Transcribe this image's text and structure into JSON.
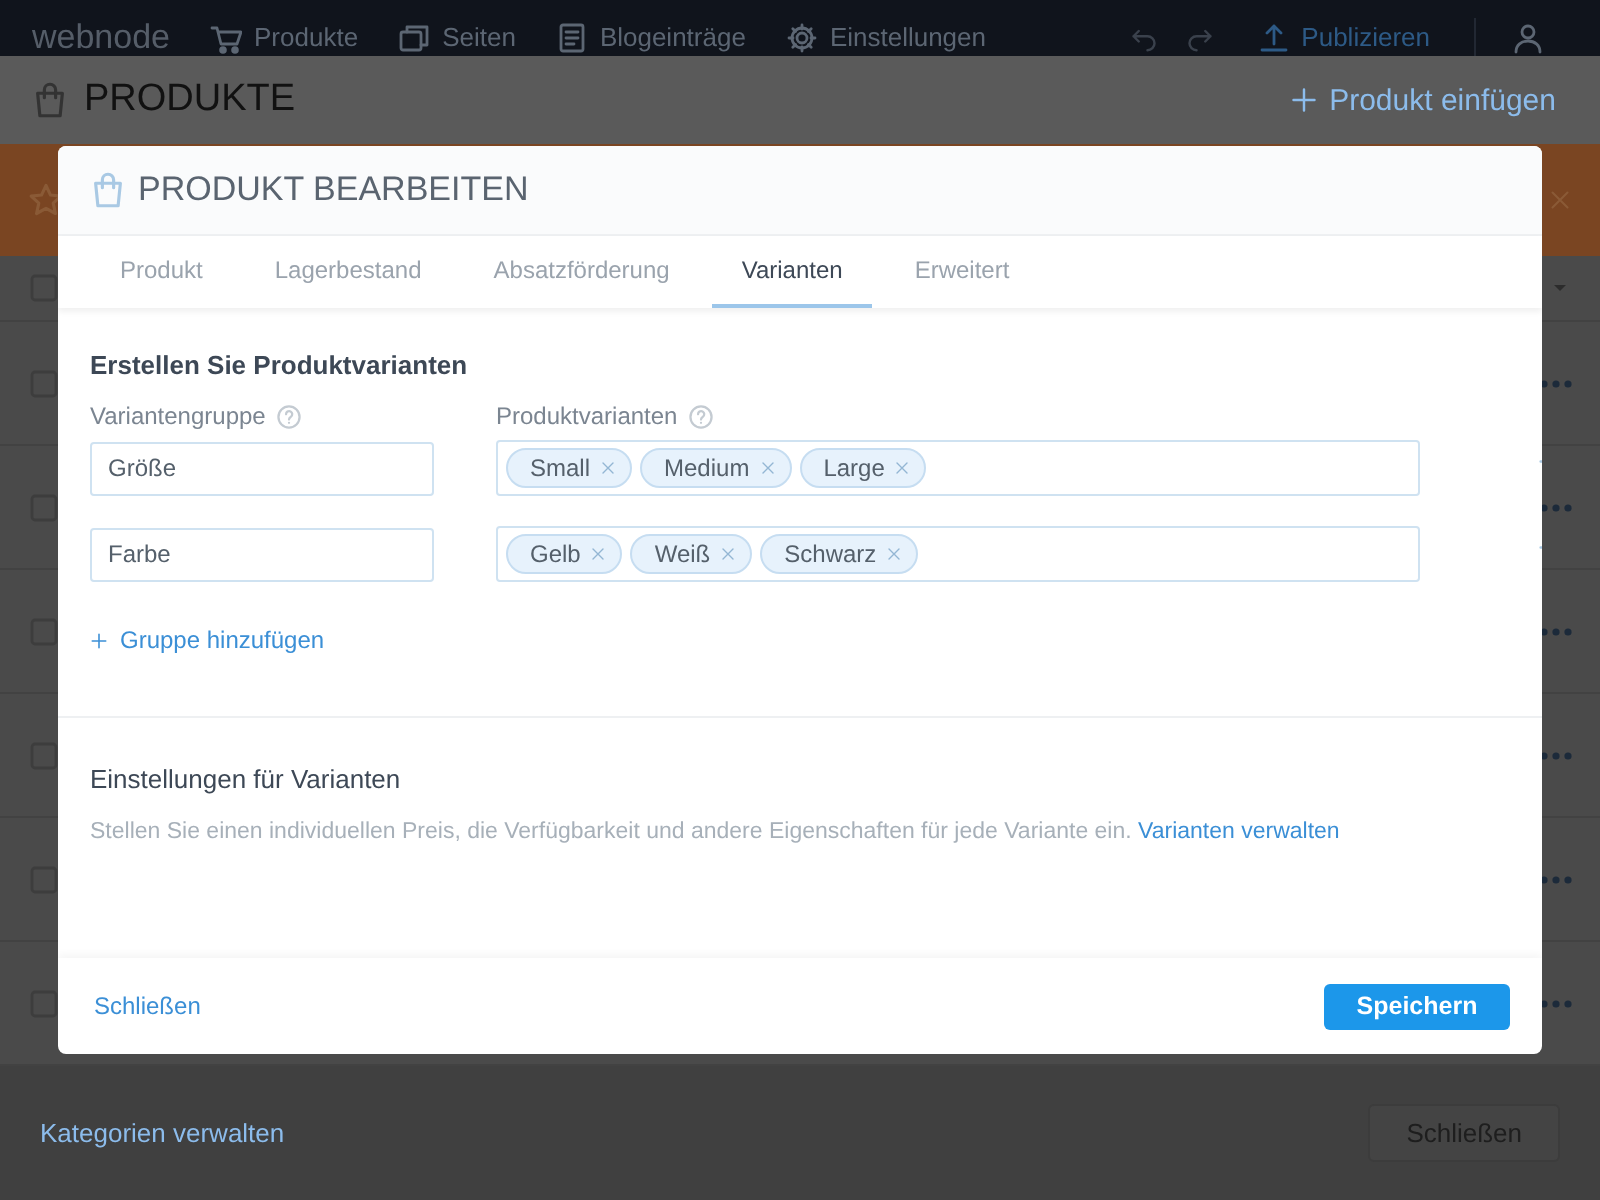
{
  "nav": {
    "logo": "webnode",
    "items": [
      {
        "label": "Produkte",
        "kind": "cart"
      },
      {
        "label": "Seiten",
        "kind": "pages"
      },
      {
        "label": "Blogeinträge",
        "kind": "posts"
      },
      {
        "label": "Einstellungen",
        "kind": "settings"
      }
    ],
    "publish": "Publizieren"
  },
  "page": {
    "title": "PRODUKTE",
    "add_label": "Produkt einfügen",
    "footer_link": "Kategorien verwalten",
    "close_button": "Schließen"
  },
  "dialog": {
    "title": "PRODUKT BEARBEITEN",
    "tabs": [
      {
        "label": "Produkt",
        "selected": false
      },
      {
        "label": "Lagerbestand",
        "selected": false
      },
      {
        "label": "Absatzförderung",
        "selected": false
      },
      {
        "label": "Varianten",
        "selected": true
      },
      {
        "label": "Erweitert",
        "selected": false
      }
    ],
    "section_title": "Erstellen Sie Produktvarianten",
    "group_label": "Variantengruppe",
    "variants_label": "Produktvarianten",
    "groups": [
      {
        "name": "Größe",
        "variants": [
          "Small",
          "Medium",
          "Large"
        ]
      },
      {
        "name": "Farbe",
        "variants": [
          "Gelb",
          "Weiß",
          "Schwarz"
        ]
      }
    ],
    "add_group": "Gruppe hinzufügen",
    "settings_title": "Einstellungen für Varianten",
    "settings_text": "Stellen Sie einen individuellen Preis, die Verfügbarkeit und andere Eigenschaften für jede Variante ein.",
    "settings_link": "Varianten verwalten",
    "close": "Schließen",
    "save": "Speichern"
  }
}
